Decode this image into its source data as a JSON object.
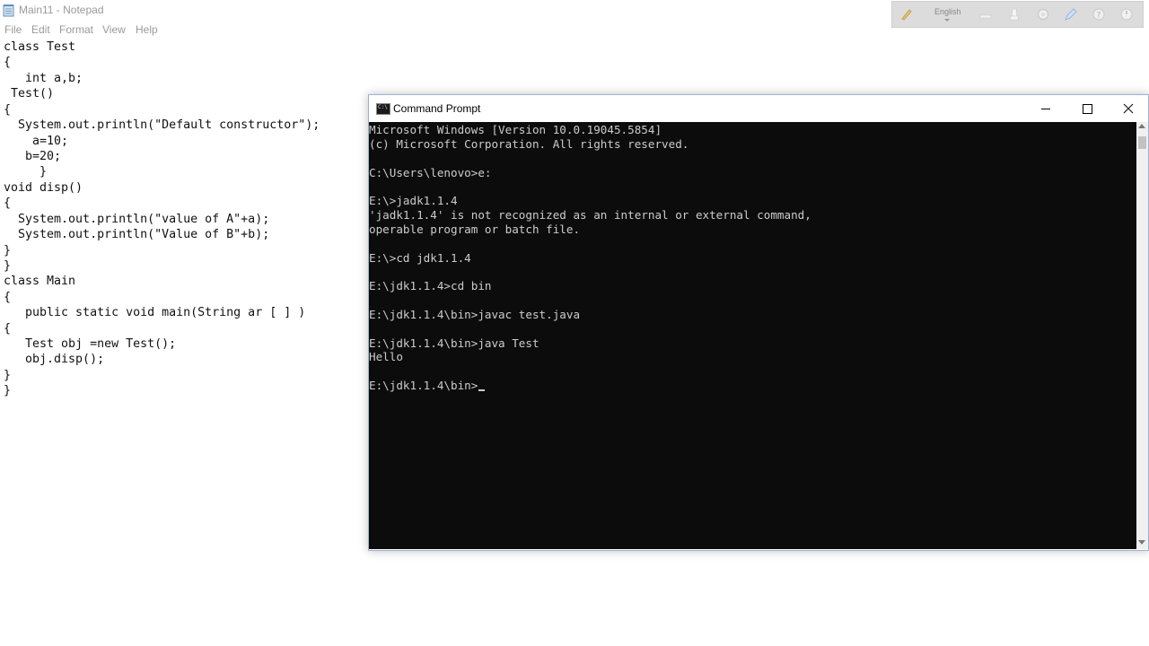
{
  "notepad": {
    "title": "Main11 - Notepad",
    "menu": [
      "File",
      "Edit",
      "Format",
      "View",
      "Help"
    ],
    "code_lines": [
      "class Test",
      "{",
      "   int a,b;",
      " Test()",
      "{",
      "  System.out.println(\"Default constructor\");",
      "    a=10;",
      "   b=20;",
      "     }",
      "void disp()",
      "{",
      "  System.out.println(\"value of A\"+a);",
      "  System.out.println(\"Value of B\"+b);",
      "}",
      "}",
      "class Main",
      "{",
      "   public static void main(String ar [ ] )",
      "{",
      "   Test obj =new Test();",
      "   obj.disp();",
      "}",
      "}"
    ]
  },
  "ink_toolbar": {
    "language": "English",
    "icons": [
      "pen-icon",
      "dash-icon",
      "broom-icon",
      "gear-icon",
      "pencil-icon",
      "help-icon",
      "power-icon"
    ]
  },
  "cmd": {
    "title": "Command Prompt",
    "icon_text": "C:\\",
    "console_lines": [
      "Microsoft Windows [Version 10.0.19045.5854]",
      "(c) Microsoft Corporation. All rights reserved.",
      "",
      "C:\\Users\\lenovo>e:",
      "",
      "E:\\>jadk1.1.4",
      "'jadk1.1.4' is not recognized as an internal or external command,",
      "operable program or batch file.",
      "",
      "E:\\>cd jdk1.1.4",
      "",
      "E:\\jdk1.1.4>cd bin",
      "",
      "E:\\jdk1.1.4\\bin>javac test.java",
      "",
      "E:\\jdk1.1.4\\bin>java Test",
      "Hello",
      "",
      "E:\\jdk1.1.4\\bin>"
    ]
  },
  "colors": {
    "console_bg": "#0c0c0c",
    "console_text": "#cccccc",
    "notepad_chrome_text": "#9a9a9a"
  }
}
